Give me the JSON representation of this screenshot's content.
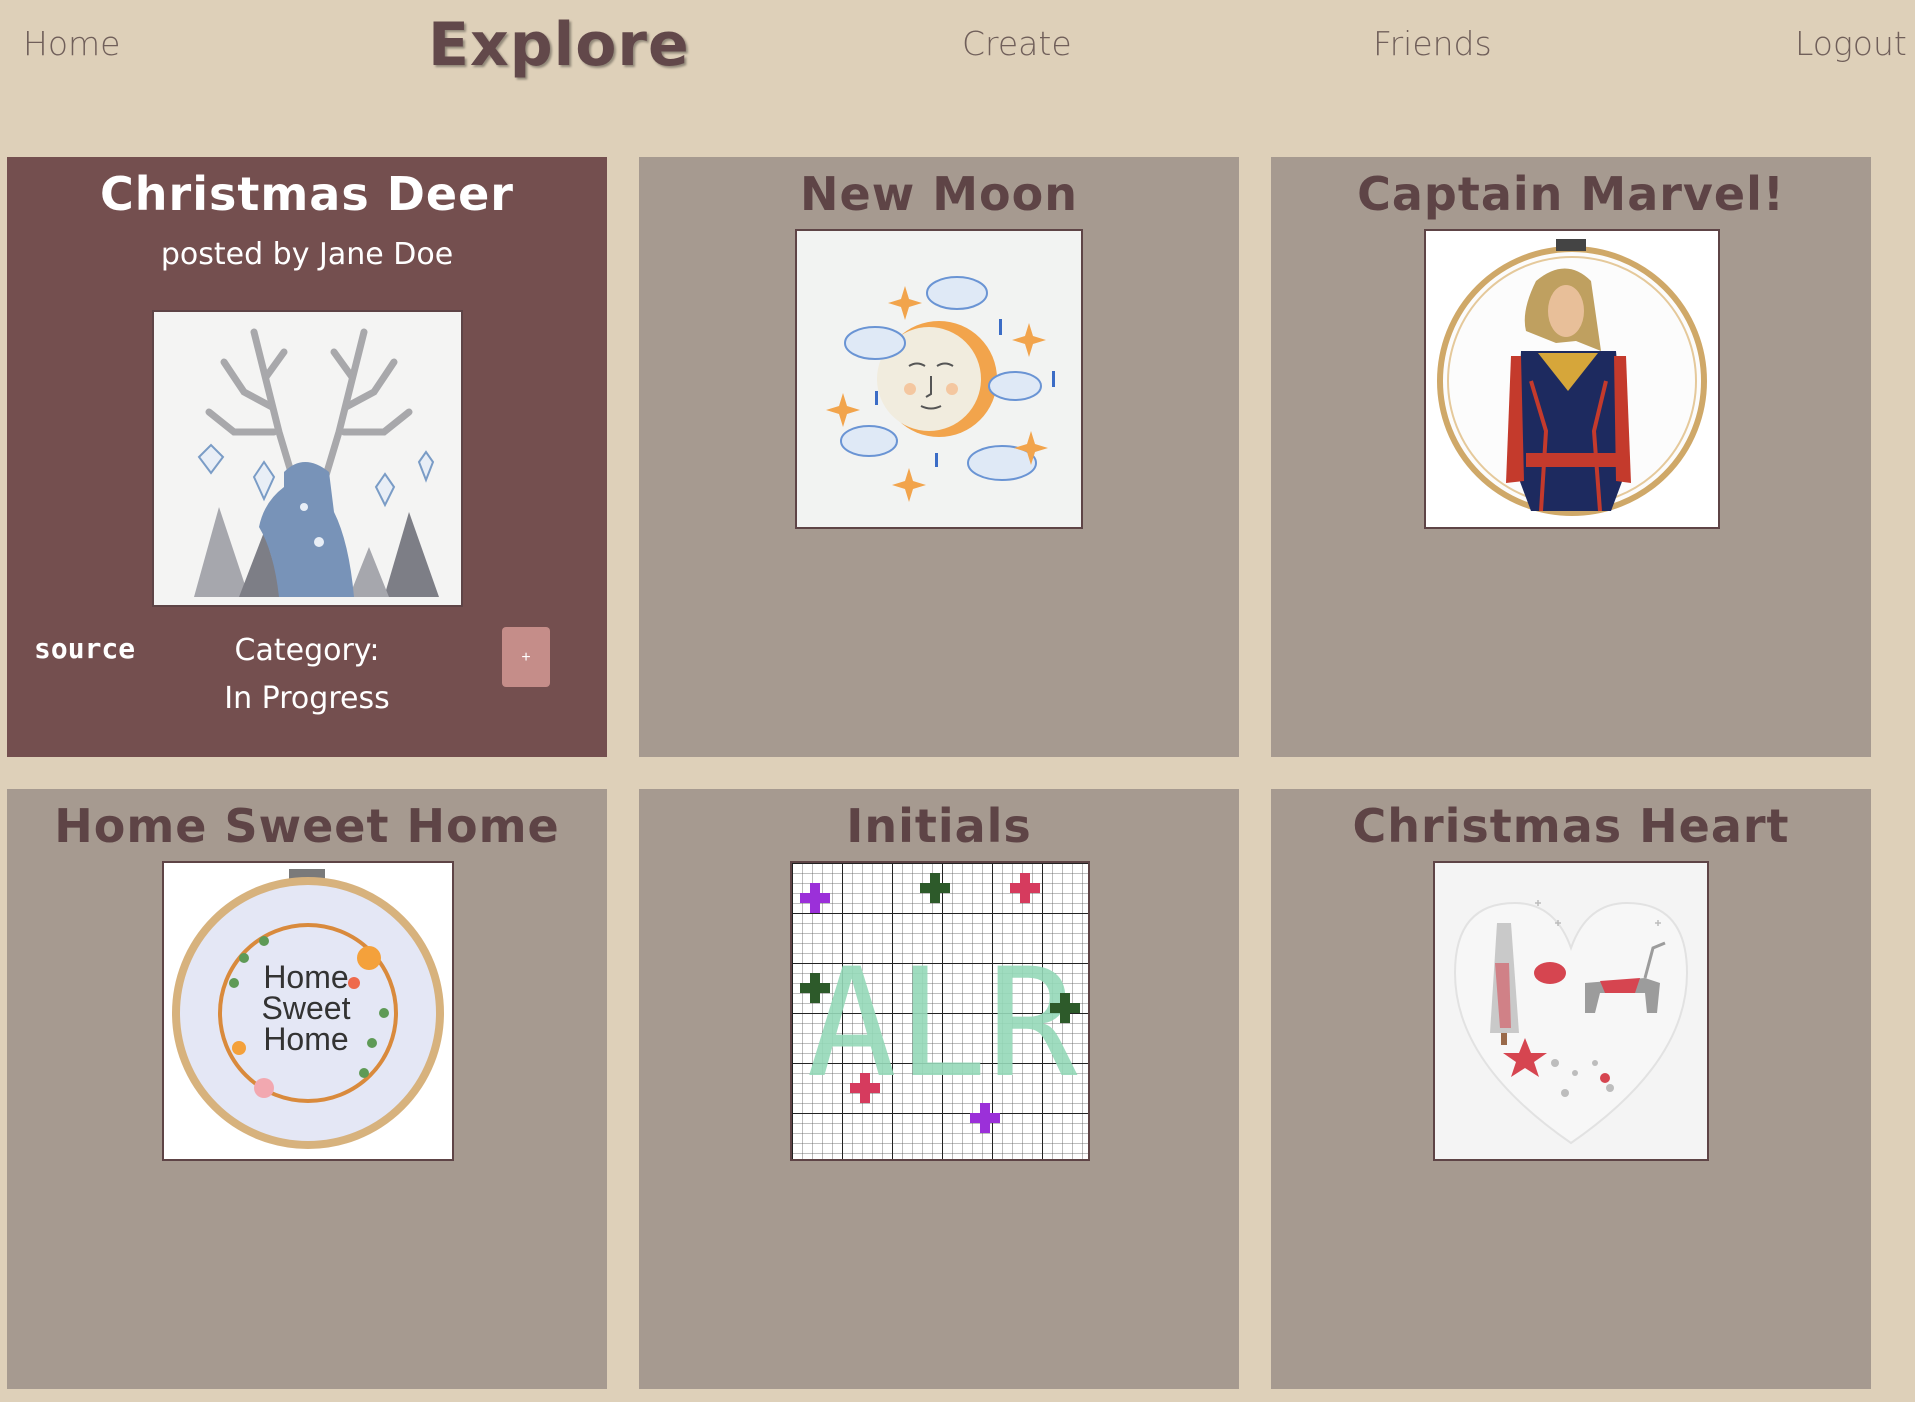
{
  "nav": {
    "home": "Home",
    "title": "Explore",
    "create": "Create",
    "friends": "Friends",
    "logout": "Logout"
  },
  "colors": {
    "page_bg": "#ded0b9",
    "card_bg": "#a69a90",
    "card_active_bg": "#744f4f",
    "title_text": "#5e4446",
    "plus_button": "#c58d89"
  },
  "cards": [
    {
      "title": "Christmas Deer",
      "posted_by": "posted by Jane Doe",
      "source_label": "source",
      "category_label": "Category:",
      "category_value": "In Progress",
      "add_button": "+",
      "image": "deer-cross-stitch-image"
    },
    {
      "title": "New Moon",
      "image": "moon-cross-stitch-image"
    },
    {
      "title": "Captain Marvel!",
      "image": "captain-marvel-cross-stitch-image"
    },
    {
      "title": "Home Sweet Home",
      "image": "home-sweet-home-hoop-image",
      "image_text": [
        "Home",
        "Sweet",
        "Home"
      ]
    },
    {
      "title": "Initials",
      "image": "initials-grid-image",
      "image_text": "ALR"
    },
    {
      "title": "Christmas Heart",
      "image": "christmas-heart-image"
    }
  ]
}
